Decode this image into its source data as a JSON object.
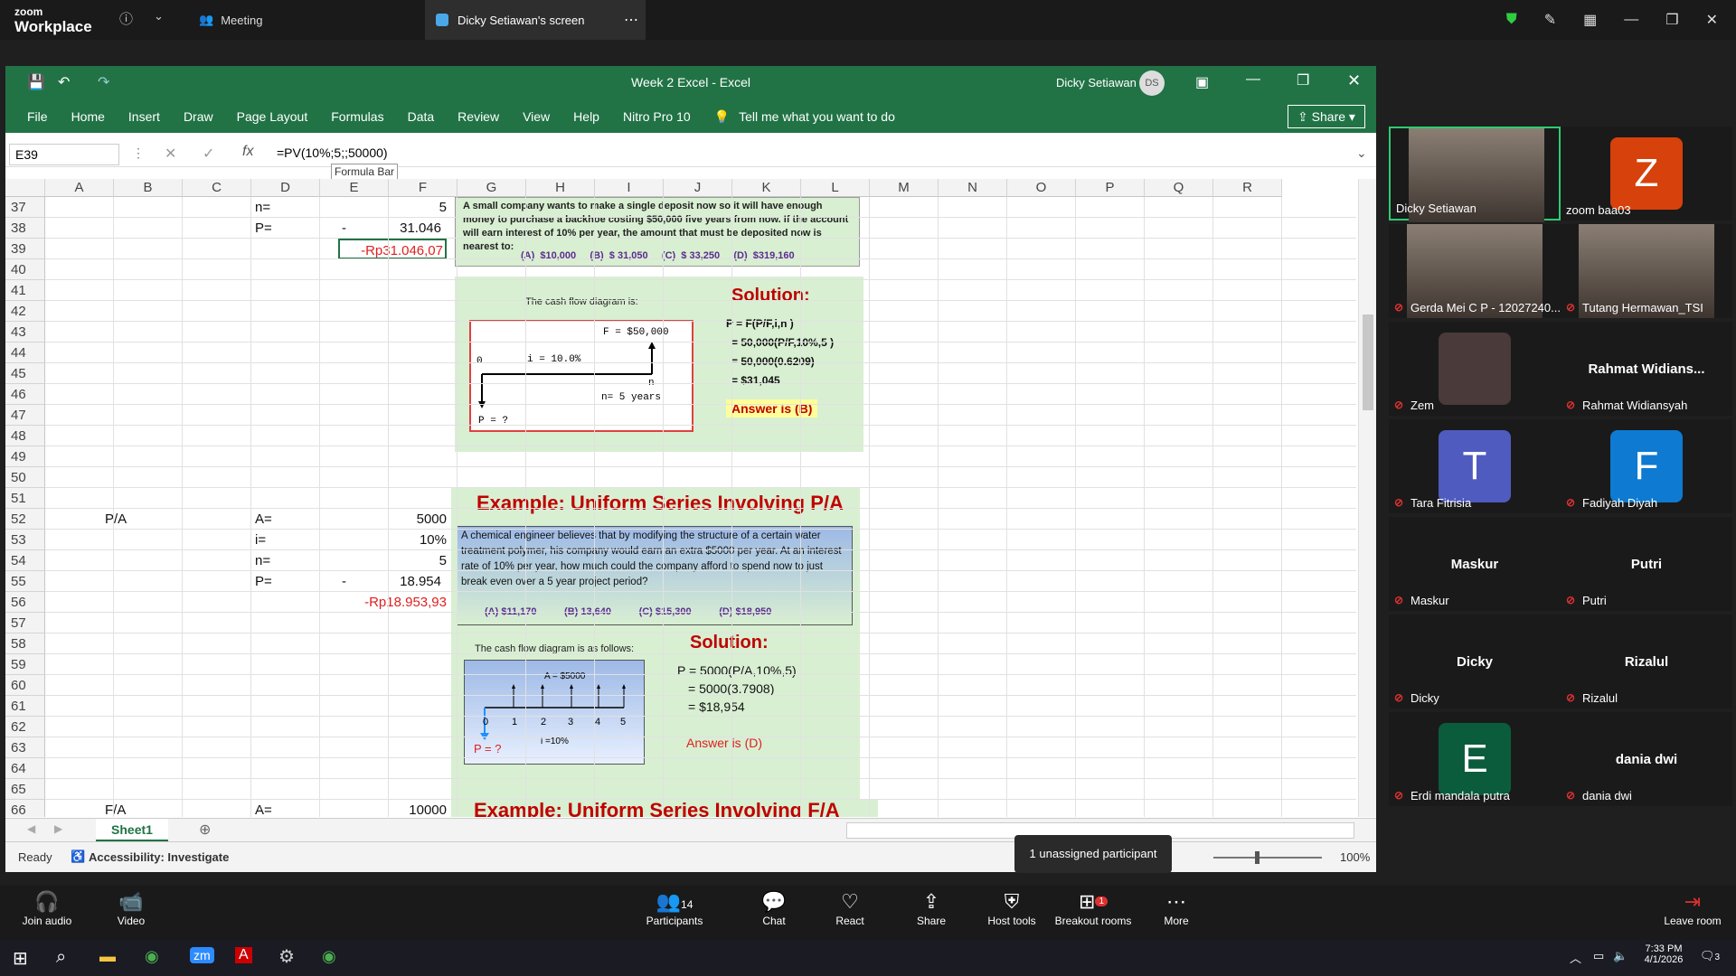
{
  "zoom": {
    "logo_line1": "zoom",
    "logo_line2": "Workplace",
    "meeting_tab": "Meeting",
    "screen_tab": "Dicky Setiawan's screen"
  },
  "excel": {
    "title": "Week 2 Excel  -  Excel",
    "user": "Dicky Setiawan",
    "user_initials": "DS",
    "menu": [
      "File",
      "Home",
      "Insert",
      "Draw",
      "Page Layout",
      "Formulas",
      "Data",
      "Review",
      "View",
      "Help",
      "Nitro Pro 10"
    ],
    "tell_me": "Tell me what you want to do",
    "share": "Share",
    "namebox": "E39",
    "formula": "=PV(10%;5;;50000)",
    "formula_tooltip": "Formula Bar",
    "columns": [
      "A",
      "B",
      "C",
      "D",
      "E",
      "F",
      "G",
      "H",
      "I",
      "J",
      "K",
      "L",
      "M",
      "N",
      "O",
      "P",
      "Q",
      "R"
    ],
    "rows": [
      "37",
      "38",
      "39",
      "40",
      "41",
      "42",
      "43",
      "44",
      "45",
      "46",
      "47",
      "48",
      "49",
      "50",
      "51",
      "52",
      "53",
      "54",
      "55",
      "56",
      "57",
      "58",
      "59",
      "60",
      "61",
      "62",
      "63",
      "64",
      "65",
      "66"
    ],
    "cells": {
      "d37": "n=",
      "e37": "5",
      "d38": "P=",
      "e38_dash": "-",
      "e38": "31.046",
      "e39": "-Rp31.046,07",
      "b51": "P/A",
      "d51": "A=",
      "e51": "5000",
      "d52": "i=",
      "e52": "10%",
      "d53": "n=",
      "e53": "5",
      "d54": "P=",
      "e54_dash": "-",
      "e54": "18.954",
      "e55": "-Rp18.953,93",
      "b66": "F/A",
      "d66": "A=",
      "e66": "10000"
    },
    "slide1": {
      "question": "A small company wants to make a single deposit now so it will have enough money to purchase a backhoe costing $50,000 five years from now.  If the account will earn interest of 10% per year, the amount that must be deposited now is nearest to:",
      "options": "(A)  $10,000     (B)  $ 31,050     (C)  $ 33,250     (D)  $319,160",
      "diagram_caption": "The cash flow diagram is:",
      "f_label": "F = $50,000",
      "i_label": "i = 10.0%",
      "zero": "0",
      "n_label": "n",
      "years": "n= 5 years",
      "p_label": "P = ?",
      "solution": "Solution:",
      "sol_lines": [
        "P = F(P/F,i,n )",
        "= 50,000(P/F,10%,5 )",
        "= 50,000(0.6209)",
        "= $31,045"
      ],
      "answer": "Answer is (B)"
    },
    "slide2": {
      "title": "Example: Uniform Series Involving P/A",
      "question": "A chemical engineer believes that by  modifying the structure of a certain water treatment polymer, his company would earn an extra $5000 per year. At an interest rate of 10% per year, how much could the company afford to spend now to just break even over a 5 year project period?",
      "options": "(A) $11,170          (B) 13,640          (C) $15,300          (D) $18,950",
      "diagram_caption": "The cash flow diagram is as follows:",
      "a_label": "A = $5000",
      "ticks": [
        "0",
        "1",
        "2",
        "3",
        "4",
        "5"
      ],
      "p_label": "P = ?",
      "i_label": "i =10%",
      "solution": "Solution:",
      "sol_lines": [
        "P = 5000(P/A,10%,5)",
        "= 5000(3.7908)",
        "= $18,954"
      ],
      "answer": "Answer is (D)"
    },
    "slide3_title": "Example: Uniform Series Involving F/A",
    "sheet_tab": "Sheet1",
    "status_ready": "Ready",
    "accessibility": "Accessibility: Investigate",
    "zoom_pct": "100%"
  },
  "tooltip_unassigned": "1 unassigned participant",
  "gallery": [
    {
      "name": "Dicky Setiawan",
      "type": "video"
    },
    {
      "name": "zoom baa03",
      "type": "avatar",
      "letter": "Z",
      "color": "#d7410b"
    },
    {
      "name": "Gerda Mei C P - 12027240...",
      "type": "video"
    },
    {
      "name": "Tutang Hermawan_TSI",
      "type": "video"
    },
    {
      "name": "Zem",
      "type": "avatar",
      "letter": "",
      "color": "#4a3a3a"
    },
    {
      "name": "Rahmat Widiansyah",
      "type": "text",
      "big": "Rahmat  Widians..."
    },
    {
      "name": "Tara Fitrisia",
      "type": "avatar",
      "letter": "T",
      "color": "#4f5bbf"
    },
    {
      "name": "Fadiyah Diyah",
      "type": "avatar",
      "letter": "F",
      "color": "#0e7ad1"
    },
    {
      "name": "Maskur",
      "type": "text",
      "big": "Maskur"
    },
    {
      "name": "Putri",
      "type": "text",
      "big": "Putri"
    },
    {
      "name": "Dicky",
      "type": "text",
      "big": "Dicky"
    },
    {
      "name": "Rizalul",
      "type": "text",
      "big": "Rizalul"
    },
    {
      "name": "Erdi mandala putra",
      "type": "avatar",
      "letter": "E",
      "color": "#0b5c3c"
    },
    {
      "name": "dania dwi",
      "type": "text",
      "big": "dania dwi"
    }
  ],
  "bottom": {
    "join_audio": "Join audio",
    "video": "Video",
    "participants": "Participants",
    "participants_count": "14",
    "chat": "Chat",
    "react": "React",
    "share": "Share",
    "host_tools": "Host tools",
    "breakout": "Breakout rooms",
    "breakout_badge": "1",
    "more": "More",
    "leave": "Leave room"
  },
  "taskbar": {
    "time": "7:33 PM",
    "date": "4/1/2026",
    "notif": "3"
  }
}
